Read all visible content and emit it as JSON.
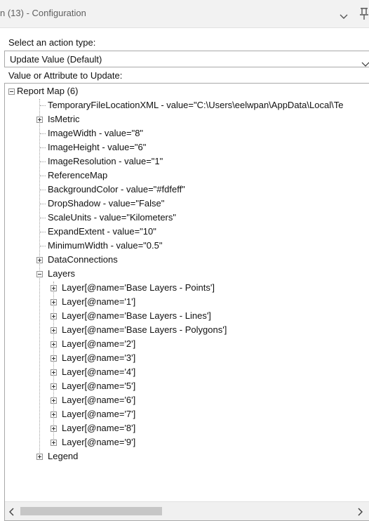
{
  "window": {
    "title": "n (13) - Configuration",
    "collapse_icon": "chevron-down-icon",
    "pin_icon": "pin-icon"
  },
  "action_type": {
    "label": "Select an action type:",
    "selected": "Update Value (Default)"
  },
  "tree_section": {
    "label": "Value or Attribute to Update:"
  },
  "tree": {
    "root": "Report Map (6)",
    "children": [
      "TemporaryFileLocationXML - value=\"C:\\Users\\eelwpan\\AppData\\Local\\Te",
      "IsMetric",
      "ImageWidth - value=\"8\"",
      "ImageHeight - value=\"6\"",
      "ImageResolution - value=\"1\"",
      "ReferenceMap",
      "BackgroundColor - value=\"#fdfeff\"",
      "DropShadow - value=\"False\"",
      "ScaleUnits - value=\"Kilometers\"",
      "ExpandExtent - value=\"10\"",
      "MinimumWidth - value=\"0.5\"",
      "DataConnections",
      "Layers",
      "Legend"
    ],
    "layers": [
      "Layer[@name='Base Layers - Points']",
      "Layer[@name='1']",
      "Layer[@name='Base Layers - Lines']",
      "Layer[@name='Base Layers - Polygons']",
      "Layer[@name='2']",
      "Layer[@name='3']",
      "Layer[@name='4']",
      "Layer[@name='5']",
      "Layer[@name='6']",
      "Layer[@name='7']",
      "Layer[@name='8']",
      "Layer[@name='9']"
    ]
  }
}
